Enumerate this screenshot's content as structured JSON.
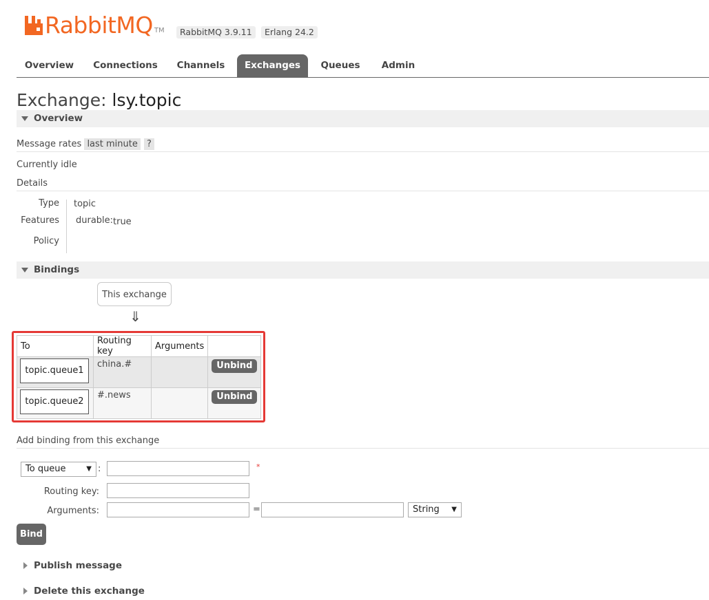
{
  "header": {
    "logo_text": "RabbitMQ",
    "logo_tm": "TM",
    "version": "RabbitMQ 3.9.11",
    "erlang": "Erlang 24.2",
    "brand_color": "#f26722"
  },
  "nav": {
    "tabs": [
      "Overview",
      "Connections",
      "Channels",
      "Exchanges",
      "Queues",
      "Admin"
    ],
    "active": "Exchanges"
  },
  "page": {
    "title_prefix": "Exchange:",
    "exchange_name": "lsy.topic"
  },
  "overview": {
    "section_label": "Overview",
    "message_rates_label": "Message rates",
    "rate_period": "last minute",
    "help": "?",
    "status": "Currently idle",
    "details_label": "Details",
    "type_label": "Type",
    "type_value": "topic",
    "features_label": "Features",
    "feature_key": "durable:",
    "feature_value": "true",
    "policy_label": "Policy"
  },
  "bindings": {
    "section_label": "Bindings",
    "source_label": "This exchange",
    "arrow": "⇓",
    "columns": [
      "To",
      "Routing key",
      "Arguments",
      ""
    ],
    "rows": [
      {
        "to": "topic.queue1",
        "routing_key": "china.#",
        "arguments": "",
        "action": "Unbind"
      },
      {
        "to": "topic.queue2",
        "routing_key": "#.news",
        "arguments": "",
        "action": "Unbind"
      }
    ],
    "highlight_color": "#e53935"
  },
  "add_binding": {
    "heading": "Add binding from this exchange",
    "destination_type": "To queue",
    "colon": ":",
    "required_mark": "*",
    "routing_key_label": "Routing key:",
    "arguments_label": "Arguments:",
    "equals": "=",
    "arg_type": "String",
    "bind_button": "Bind"
  },
  "collapsed_sections": {
    "publish": "Publish message",
    "delete": "Delete this exchange"
  }
}
